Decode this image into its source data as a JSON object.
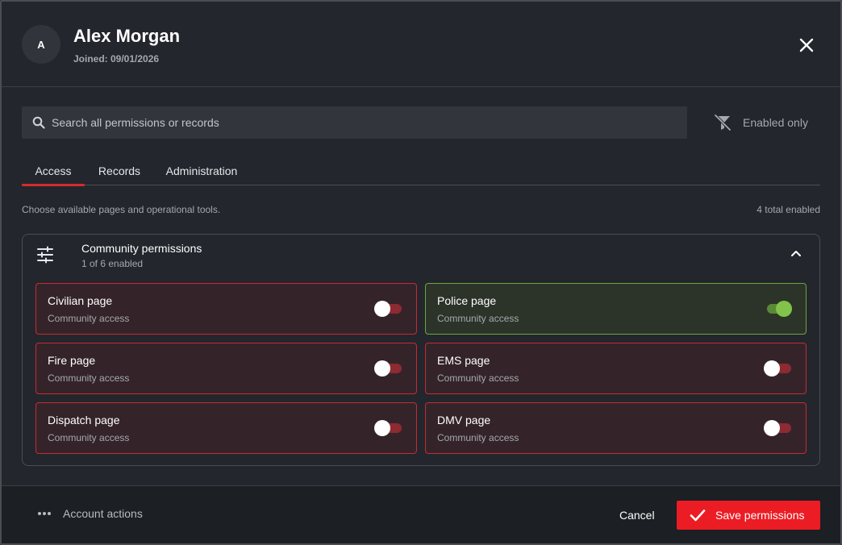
{
  "user": {
    "avatar_initial": "A",
    "name": "Alex Morgan",
    "joined": "Joined: 09/01/2026"
  },
  "search": {
    "value": "",
    "placeholder": "Search all permissions or records"
  },
  "filter": {
    "label": "Enabled only",
    "icon": "filter-off-icon"
  },
  "tabs": [
    {
      "label": "Access",
      "active": true
    },
    {
      "label": "Records",
      "active": false
    },
    {
      "label": "Administration",
      "active": false
    }
  ],
  "description": "Choose available pages and operational tools.",
  "total_enabled": "4 total enabled",
  "section": {
    "title": "Community permissions",
    "subtitle": "1 of 6 enabled",
    "icon": "sliders-icon",
    "expanded": true
  },
  "permissions": [
    {
      "title": "Civilian page",
      "subtitle": "Community access",
      "enabled": false
    },
    {
      "title": "Police page",
      "subtitle": "Community access",
      "enabled": true
    },
    {
      "title": "Fire page",
      "subtitle": "Community access",
      "enabled": false
    },
    {
      "title": "EMS page",
      "subtitle": "Community access",
      "enabled": false
    },
    {
      "title": "Dispatch page",
      "subtitle": "Community access",
      "enabled": false
    },
    {
      "title": "DMV page",
      "subtitle": "Community access",
      "enabled": false
    }
  ],
  "footer": {
    "account_actions": "Account actions",
    "cancel": "Cancel",
    "save": "Save permissions"
  },
  "colors": {
    "accent": "#ec1c24",
    "enabled": "#82c34a",
    "disabled_border": "#c92a33",
    "enabled_border": "#6fa33e"
  }
}
